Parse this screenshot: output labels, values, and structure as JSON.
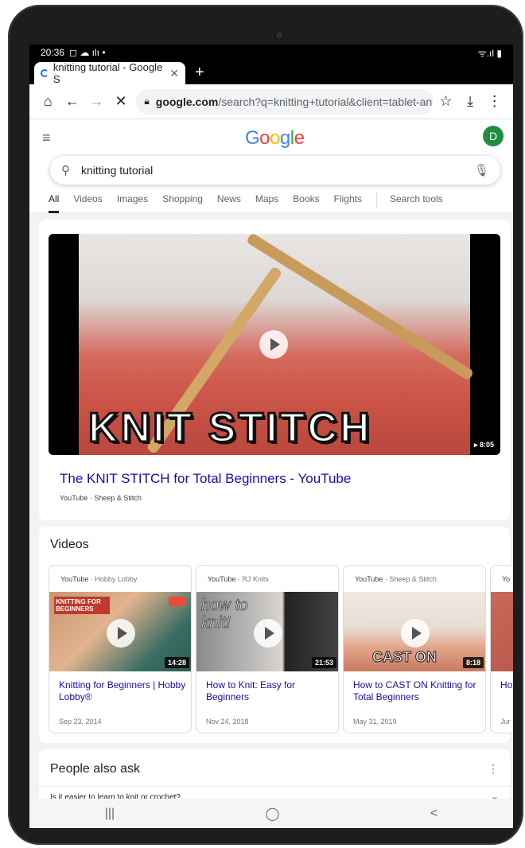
{
  "status_bar": {
    "time": "20:36",
    "left_icons": "◻ ☁ ılı •",
    "right_icons": "ᯤ.ıl ▮"
  },
  "browser": {
    "tab_title": "knitting tutorial - Google S",
    "tab_close": "✕",
    "new_tab": "+",
    "url_host": "google.com",
    "url_path": "/search?q=knitting+tutorial&client=tablet-an",
    "icons": {
      "home": "⌂",
      "back": "←",
      "forward": "→",
      "stop": "✕",
      "star": "☆",
      "download": "⤓",
      "menu": "⋮"
    }
  },
  "google": {
    "menu_icon": "≡",
    "logo": {
      "G": "G",
      "o1": "o",
      "o2": "o",
      "g": "g",
      "l": "l",
      "e": "e"
    },
    "avatar_letter": "D",
    "query": "knitting tutorial",
    "tabs": [
      "All",
      "Videos",
      "Images",
      "Shopping",
      "News",
      "Maps",
      "Books",
      "Flights"
    ],
    "search_tools": "Search tools"
  },
  "featured_video": {
    "thumb_text": "KNIT STITCH",
    "duration": "▸ 8:05",
    "title": "The KNIT STITCH for Total Beginners - YouTube",
    "source": "YouTube · Sheep & Stitch"
  },
  "videos_section": {
    "heading": "Videos",
    "items": [
      {
        "site": "YouTube",
        "channel": "· Hobby Lobby",
        "duration": "14:28",
        "title": "Knitting for Beginners | Hobby Lobby®",
        "date": "Sep 23, 2014",
        "thumb_label": "KNITTING FOR BEGINNERS"
      },
      {
        "site": "YouTube",
        "channel": "· RJ Knits",
        "duration": "21:53",
        "title": "How to Knit: Easy for Beginners",
        "date": "Nov 24, 2018",
        "thumb_label": "how to knit!"
      },
      {
        "site": "YouTube",
        "channel": "· Sheep & Stitch",
        "duration": "8:18",
        "title": "How to CAST ON Knitting for Total Beginners",
        "date": "May 31, 2019",
        "thumb_label": "CAST ON"
      },
      {
        "site": "Yo",
        "channel": "",
        "duration": "",
        "title": "Ho BE",
        "date": "Jur",
        "thumb_label": ""
      }
    ]
  },
  "people_also_ask": {
    "heading": "People also ask",
    "menu": "⋮",
    "question": "Is it easier to learn to knit or crochet?",
    "chevron": "⌄"
  },
  "android_nav": {
    "recents": "|||",
    "home": "◯",
    "back": "<"
  }
}
